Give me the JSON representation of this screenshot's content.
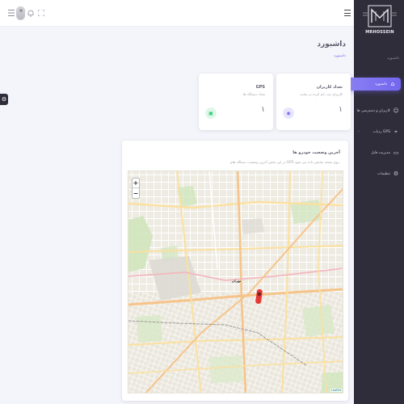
{
  "topbar": {
    "icons": [
      "grid-icon",
      "fullscreen-icon",
      "bell-icon",
      "avatar"
    ]
  },
  "sidebar": {
    "logo_text": "MRHOSSEIN",
    "subtitle": "داشبورد",
    "items": [
      {
        "label": "داشبورد",
        "icon": "home-icon",
        "active": true
      },
      {
        "label": "کاربران و دسترسی ها",
        "icon": "user-icon",
        "has_arrow": true
      },
      {
        "label": "ردیاب GPS",
        "icon": "location-icon",
        "has_arrow": true
      },
      {
        "label": "مدیریت فایل",
        "icon": "file-icon"
      },
      {
        "label": "تنظیمات",
        "icon": "settings-icon"
      }
    ]
  },
  "page": {
    "title": "داشبورد",
    "breadcrumb": "داشبورد"
  },
  "cards": [
    {
      "title": "تعداد کاربران",
      "subtitle": "کاربران ثبت نام کرده در سایت",
      "value": "۱",
      "badge_color": "#7367f0"
    },
    {
      "title": "GPS",
      "subtitle": "تعداد دستگاه ها",
      "value": "۱",
      "badge_color": "#28c76f"
    }
  ],
  "map_card": {
    "title": "آخرین وضعیت خودرو ها",
    "subtitle": "در این بخش آخرین وضعیت دستگاه های GPS روی نقشه نمایش داده می شود.",
    "zoom_in": "+",
    "zoom_out": "−",
    "city_label": "تهران",
    "attribution": "Leaflet"
  },
  "colors": {
    "accent": "#7367f0",
    "sidebar_bg": "#2f2d3a",
    "success": "#28c76f",
    "car": "#e53935"
  }
}
